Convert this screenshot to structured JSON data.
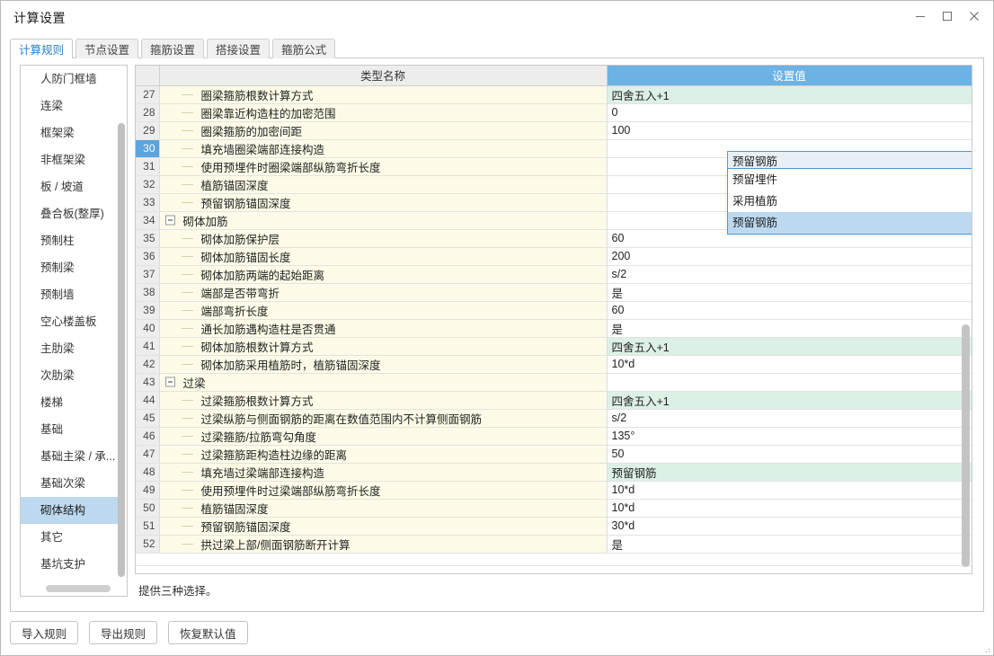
{
  "window": {
    "title": "计算设置",
    "controls": {
      "minimize": "–",
      "maximize": "□",
      "close": "✕"
    }
  },
  "tabs": [
    {
      "label": "计算规则",
      "active": true
    },
    {
      "label": "节点设置",
      "active": false
    },
    {
      "label": "箍筋设置",
      "active": false
    },
    {
      "label": "搭接设置",
      "active": false
    },
    {
      "label": "箍筋公式",
      "active": false
    }
  ],
  "sidebar": {
    "items": [
      {
        "label": "人防门框墙",
        "selected": false
      },
      {
        "label": "连梁",
        "selected": false
      },
      {
        "label": "框架梁",
        "selected": false
      },
      {
        "label": "非框架梁",
        "selected": false
      },
      {
        "label": "板 / 坡道",
        "selected": false
      },
      {
        "label": "叠合板(整厚)",
        "selected": false
      },
      {
        "label": "预制柱",
        "selected": false
      },
      {
        "label": "预制梁",
        "selected": false
      },
      {
        "label": "预制墙",
        "selected": false
      },
      {
        "label": "空心楼盖板",
        "selected": false
      },
      {
        "label": "主肋梁",
        "selected": false
      },
      {
        "label": "次肋梁",
        "selected": false
      },
      {
        "label": "楼梯",
        "selected": false
      },
      {
        "label": "基础",
        "selected": false
      },
      {
        "label": "基础主梁 / 承...",
        "selected": false
      },
      {
        "label": "基础次梁",
        "selected": false
      },
      {
        "label": "砌体结构",
        "selected": true
      },
      {
        "label": "其它",
        "selected": false
      },
      {
        "label": "基坑支护",
        "selected": false
      }
    ]
  },
  "grid": {
    "headers": {
      "num": "",
      "name": "类型名称",
      "value": "设置值"
    },
    "rows": [
      {
        "num": "27",
        "name": "圈梁箍筋根数计算方式",
        "value": "四舍五入+1",
        "kind": "child",
        "value_style": "green"
      },
      {
        "num": "28",
        "name": "圈梁靠近构造柱的加密范围",
        "value": "0",
        "kind": "child",
        "value_style": "plain"
      },
      {
        "num": "29",
        "name": "圈梁箍筋的加密间距",
        "value": "100",
        "kind": "child",
        "value_style": "plain"
      },
      {
        "num": "30",
        "name": "填充墙圈梁端部连接构造",
        "value": "预留钢筋",
        "kind": "child",
        "value_style": "editing",
        "selected": true
      },
      {
        "num": "31",
        "name": "使用预埋件时圈梁端部纵筋弯折长度",
        "value": "",
        "kind": "child",
        "value_style": "hidden"
      },
      {
        "num": "32",
        "name": "植筋锚固深度",
        "value": "",
        "kind": "child",
        "value_style": "hidden"
      },
      {
        "num": "33",
        "name": "预留钢筋锚固深度",
        "value": "",
        "kind": "child",
        "value_style": "hidden"
      },
      {
        "num": "34",
        "name": "砌体加筋",
        "value": "",
        "kind": "group",
        "value_style": "hidden"
      },
      {
        "num": "35",
        "name": "砌体加筋保护层",
        "value": "60",
        "kind": "child",
        "value_style": "plain"
      },
      {
        "num": "36",
        "name": "砌体加筋锚固长度",
        "value": "200",
        "kind": "child",
        "value_style": "plain"
      },
      {
        "num": "37",
        "name": "砌体加筋两端的起始距离",
        "value": "s/2",
        "kind": "child",
        "value_style": "plain"
      },
      {
        "num": "38",
        "name": "端部是否带弯折",
        "value": "是",
        "kind": "child",
        "value_style": "plain"
      },
      {
        "num": "39",
        "name": "端部弯折长度",
        "value": "60",
        "kind": "child",
        "value_style": "plain"
      },
      {
        "num": "40",
        "name": "通长加筋遇构造柱是否贯通",
        "value": "是",
        "kind": "child",
        "value_style": "plain"
      },
      {
        "num": "41",
        "name": "砌体加筋根数计算方式",
        "value": "四舍五入+1",
        "kind": "child",
        "value_style": "green"
      },
      {
        "num": "42",
        "name": "砌体加筋采用植筋时，植筋锚固深度",
        "value": "10*d",
        "kind": "child",
        "value_style": "plain"
      },
      {
        "num": "43",
        "name": "过梁",
        "value": "",
        "kind": "group",
        "value_style": "empty"
      },
      {
        "num": "44",
        "name": "过梁箍筋根数计算方式",
        "value": "四舍五入+1",
        "kind": "child",
        "value_style": "green"
      },
      {
        "num": "45",
        "name": "过梁纵筋与侧面钢筋的距离在数值范围内不计算侧面钢筋",
        "value": "s/2",
        "kind": "child",
        "value_style": "plain"
      },
      {
        "num": "46",
        "name": "过梁箍筋/拉筋弯勾角度",
        "value": "135°",
        "kind": "child",
        "value_style": "plain"
      },
      {
        "num": "47",
        "name": "过梁箍筋距构造柱边缘的距离",
        "value": "50",
        "kind": "child",
        "value_style": "plain"
      },
      {
        "num": "48",
        "name": "填充墙过梁端部连接构造",
        "value": "预留钢筋",
        "kind": "child",
        "value_style": "green"
      },
      {
        "num": "49",
        "name": "使用预埋件时过梁端部纵筋弯折长度",
        "value": "10*d",
        "kind": "child",
        "value_style": "plain"
      },
      {
        "num": "50",
        "name": "植筋锚固深度",
        "value": "10*d",
        "kind": "child",
        "value_style": "plain"
      },
      {
        "num": "51",
        "name": "预留钢筋锚固深度",
        "value": "30*d",
        "kind": "child",
        "value_style": "plain"
      },
      {
        "num": "52",
        "name": "拱过梁上部/侧面钢筋断开计算",
        "value": "是",
        "kind": "child",
        "value_style": "plain"
      }
    ]
  },
  "dropdown": {
    "selected_value": "预留钢筋",
    "arrow_icon": "chevron-down-icon",
    "options": [
      {
        "label": "预留埋件",
        "active": false
      },
      {
        "label": "采用植筋",
        "active": false
      },
      {
        "label": "预留钢筋",
        "active": true
      }
    ]
  },
  "hint": {
    "text": "提供三种选择。"
  },
  "footer": {
    "buttons": [
      {
        "label": "导入规则"
      },
      {
        "label": "导出规则"
      },
      {
        "label": "恢复默认值"
      }
    ]
  },
  "colors": {
    "accent_blue": "#6cb2e4",
    "select_blue": "#bcd9f0",
    "row_name_bg": "#fdfbe7",
    "green_cell": "#ddf0e5",
    "num_bg": "#ededed"
  }
}
